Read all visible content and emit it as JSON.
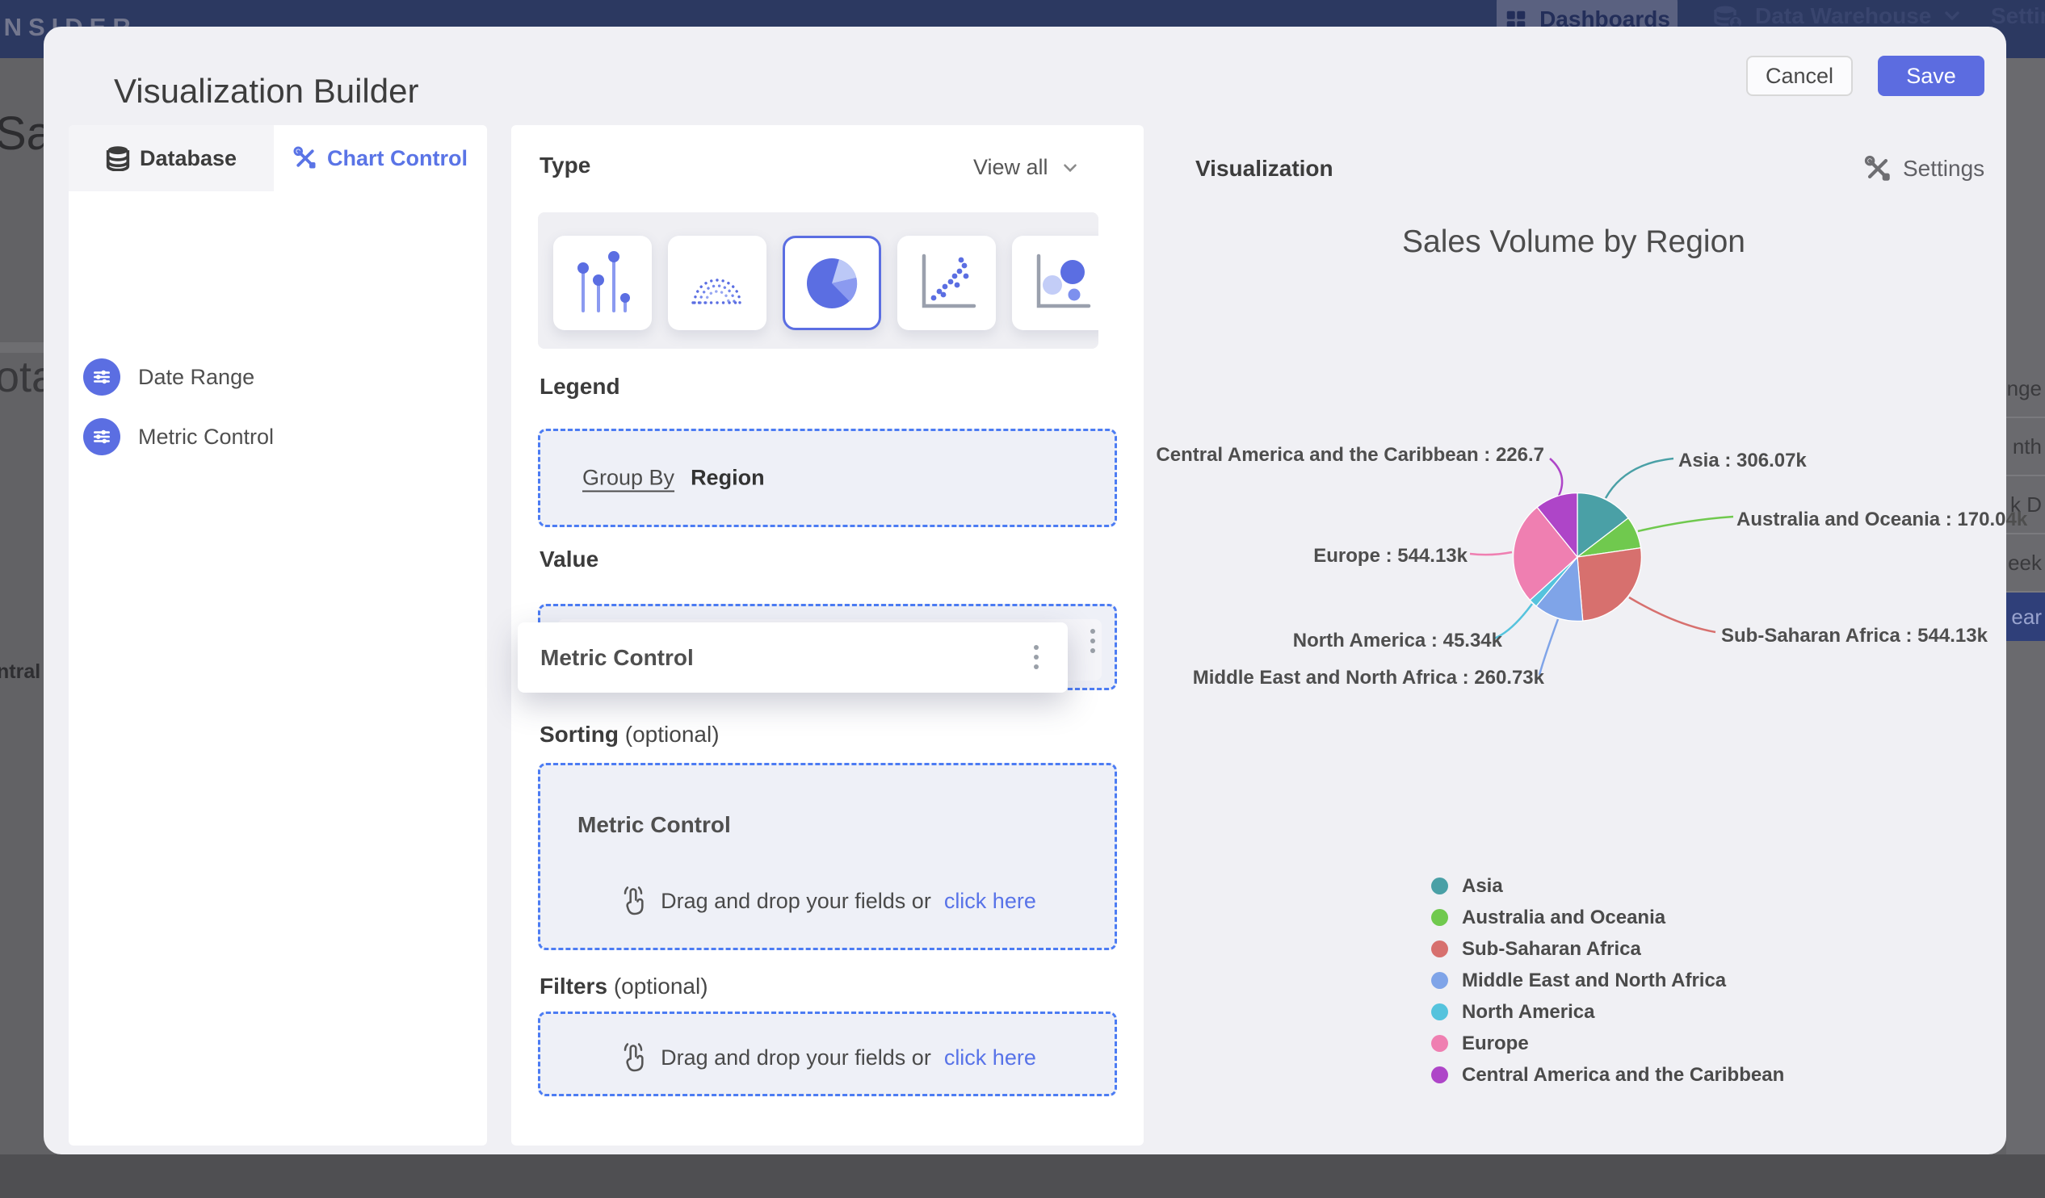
{
  "topbar": {
    "logo": "INSIDER",
    "dashboards": "Dashboards",
    "data_warehouse": "Data Warehouse",
    "settings": "Settings"
  },
  "background": {
    "left_fragments": {
      "f1": "Sal",
      "f2": "ota",
      "f3": "ntral"
    },
    "right_fragments": {
      "r1": "nge",
      "r2": "nth",
      "r3": "k D",
      "r4": "eek",
      "r5": "ear"
    }
  },
  "modal": {
    "title": "Visualization Builder",
    "cancel": "Cancel",
    "save": "Save"
  },
  "sidebar": {
    "tabs": {
      "database": "Database",
      "chart_control": "Chart Control"
    },
    "items": {
      "date_range": "Date Range",
      "metric_control": "Metric Control"
    }
  },
  "builder": {
    "type": {
      "header": "Type",
      "view_all": "View all",
      "selected_type": "pie"
    },
    "legend": {
      "header": "Legend",
      "group_by": "Group By",
      "value": "Region"
    },
    "value": {
      "header": "Value",
      "field": "Metric Control",
      "dragging_field": "Metric Control"
    },
    "sorting": {
      "header": "Sorting",
      "optional": "(optional)",
      "field": "Metric Control",
      "hint": "Drag and drop your fields or",
      "link": "click here"
    },
    "filters": {
      "header": "Filters",
      "optional": "(optional)",
      "hint": "Drag and drop your fields or",
      "link": "click here"
    }
  },
  "viz": {
    "header": "Visualization",
    "settings": "Settings"
  },
  "chart_data": {
    "type": "pie",
    "title": "Sales Volume by Region",
    "unit": "k",
    "legend_position": "bottom-left",
    "slices": [
      {
        "name": "Asia",
        "value": 306.07,
        "display": "306.07k",
        "color": "#4aa0a6",
        "label": "Asia : 306.07k"
      },
      {
        "name": "Australia and Oceania",
        "value": 170.04,
        "display": "170.04k",
        "color": "#70c94e",
        "label": "Australia and Oceania : 170.04k"
      },
      {
        "name": "Sub-Saharan Africa",
        "value": 544.13,
        "display": "544.13k",
        "color": "#d7706e",
        "label": "Sub-Saharan Africa : 544.13k"
      },
      {
        "name": "Middle East and North Africa",
        "value": 260.73,
        "display": "260.73k",
        "color": "#7fa4e8",
        "label": "Middle East and North Africa : 260.73k"
      },
      {
        "name": "North America",
        "value": 45.34,
        "display": "45.34k",
        "color": "#55c3dd",
        "label": "North America : 45.34k"
      },
      {
        "name": "Europe",
        "value": 544.13,
        "display": "544.13k",
        "color": "#ef7fb1",
        "label": "Europe : 544.13k"
      },
      {
        "name": "Central America and the Caribbean",
        "value": 226.7,
        "display": "226.7",
        "label_truncated": true,
        "color": "#ae45c8",
        "label": "Central America and the Caribbean : 226.7"
      }
    ]
  }
}
